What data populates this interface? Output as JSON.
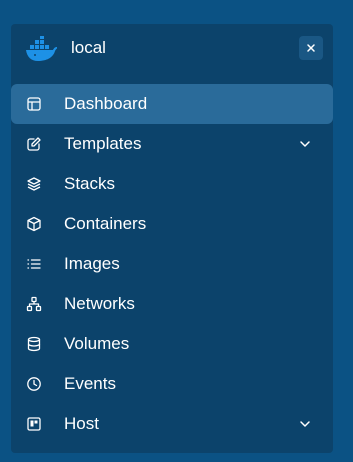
{
  "environment": {
    "name": "local",
    "logo_icon": "docker-whale-icon",
    "close_icon": "close-icon"
  },
  "nav": {
    "items": [
      {
        "label": "Dashboard",
        "icon": "layout-icon",
        "active": true
      },
      {
        "label": "Templates",
        "icon": "edit-icon",
        "expandable": true
      },
      {
        "label": "Stacks",
        "icon": "layers-icon"
      },
      {
        "label": "Containers",
        "icon": "box-icon"
      },
      {
        "label": "Images",
        "icon": "list-icon"
      },
      {
        "label": "Networks",
        "icon": "network-icon"
      },
      {
        "label": "Volumes",
        "icon": "database-icon"
      },
      {
        "label": "Events",
        "icon": "clock-icon"
      },
      {
        "label": "Host",
        "icon": "board-icon",
        "expandable": true
      }
    ]
  },
  "colors": {
    "page_background": "#0b5284",
    "panel_background": "#0c436b",
    "active_item_background": "#2a6b9a",
    "close_button_background": "#1a5784",
    "docker_blue": "#1d91e6",
    "text": "#ffffff"
  }
}
